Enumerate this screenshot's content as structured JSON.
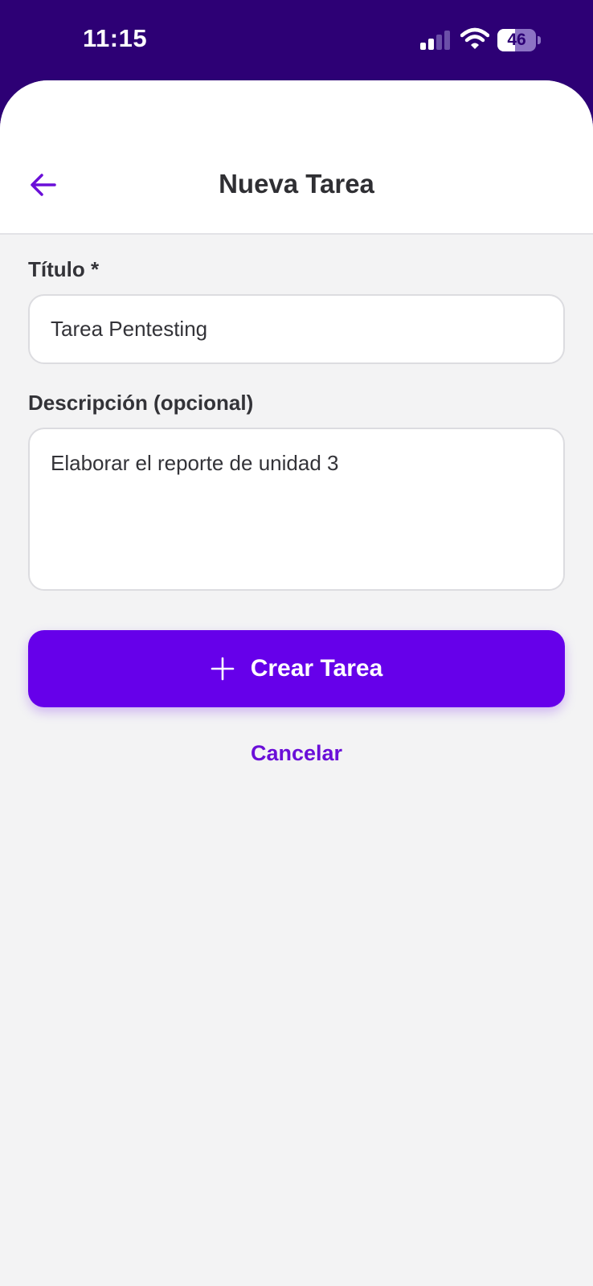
{
  "status_bar": {
    "time": "11:15",
    "battery_level": "46",
    "icons": [
      "signal-icon",
      "wifi-icon",
      "battery-icon"
    ]
  },
  "header": {
    "title": "Nueva Tarea",
    "back_icon": "arrow-left-icon"
  },
  "form": {
    "title_label": "Título *",
    "title_value": "Tarea Pentesting",
    "description_label": "Descripción (opcional)",
    "description_value": "Elaborar el reporte de unidad 3"
  },
  "actions": {
    "create_icon": "plus-icon",
    "create_label": "Crear Tarea",
    "cancel_label": "Cancelar"
  },
  "colors": {
    "status_bar_bg": "#2d0075",
    "accent": "#6600ea",
    "background": "#f3f3f4",
    "text": "#333338"
  }
}
